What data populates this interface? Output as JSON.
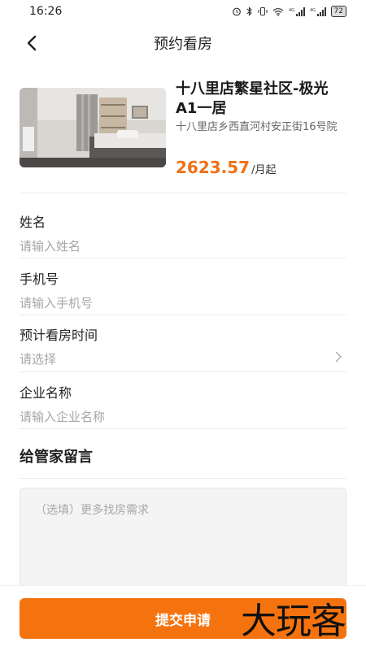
{
  "status": {
    "time": "16:26",
    "battery": "72",
    "signal_text": "4G"
  },
  "nav": {
    "title": "预约看房"
  },
  "listing": {
    "title": "十八里店繁星社区-极光A1一居",
    "address": "十八里店乡西直河村安正街16号院",
    "price": "2623.57",
    "price_unit": "/月起"
  },
  "form": {
    "fields": [
      {
        "label": "姓名",
        "placeholder": "请输入姓名"
      },
      {
        "label": "手机号",
        "placeholder": "请输入手机号"
      },
      {
        "label": "预计看房时间",
        "placeholder": "请选择"
      },
      {
        "label": "企业名称",
        "placeholder": "请输入企业名称"
      }
    ],
    "message_title": "给管家留言",
    "message_placeholder": "（选填）更多找房需求"
  },
  "footer": {
    "submit_label": "提交申请",
    "watermark": "大玩客"
  },
  "colors": {
    "accent": "#f5730e",
    "price": "#f07116"
  }
}
